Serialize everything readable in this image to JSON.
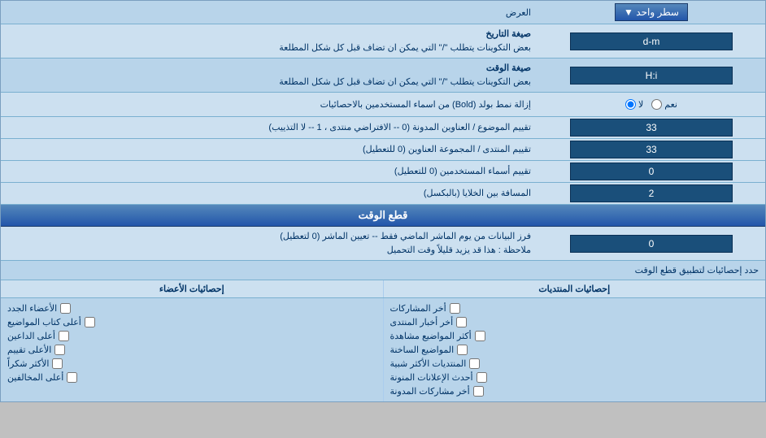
{
  "header": {
    "display_label": "العرض",
    "display_dropdown_label": "سطر واحد",
    "display_dropdown_icon": "▼"
  },
  "date_format": {
    "label": "صيغة التاريخ",
    "sublabel": "بعض التكوينات يتطلب \"/\" التي يمكن ان تضاف قبل كل شكل المطلعة",
    "value": "d-m"
  },
  "time_format": {
    "label": "صيغة الوقت",
    "sublabel": "بعض التكوينات يتطلب \"/\" التي يمكن ان تضاف قبل كل شكل المطلعة",
    "value": "H:i"
  },
  "bold_remove": {
    "label": "إزالة نمط بولد (Bold) من اسماء المستخدمين بالاحصائيات",
    "option_yes": "نعم",
    "option_no": "لا",
    "selected": "no"
  },
  "topic_sort": {
    "label": "تقييم الموضوع / العناوين المدونة (0 -- الافتراضي منتدى ، 1 -- لا التذييب)",
    "value": "33"
  },
  "forum_sort": {
    "label": "تقييم المنتدى / المجموعة العناوين (0 للتعطيل)",
    "value": "33"
  },
  "user_sort": {
    "label": "تقييم أسماء المستخدمين (0 للتعطيل)",
    "value": "0"
  },
  "cell_spacing": {
    "label": "المسافة بين الخلايا (بالبكسل)",
    "value": "2"
  },
  "cutoff_section": {
    "title": "قطع الوقت"
  },
  "cutoff_days": {
    "label": "فرز البيانات من يوم الماشر الماضي فقط -- تعيين الماشر (0 لتعطيل)",
    "sublabel": "ملاحظة : هذا قد يزيد قليلاً وقت التحميل",
    "value": "0"
  },
  "stats_apply": {
    "label": "حدد إحصائيات لتطبيق قطع الوقت"
  },
  "stats_columns": {
    "col1": "إحصائيات المنتديات",
    "col2": "إحصائيات الأعضاء"
  },
  "stats_col1_items": [
    "أخر المشاركات",
    "أخر أخبار المنتدى",
    "أكثر المواضيع مشاهدة",
    "المواضيع الساخنة",
    "المنتديات الأكثر شبية",
    "أحدث الإعلانات المنونة",
    "أخر مشاركات المدونة"
  ],
  "stats_col2_items": [
    "الأعضاء الجدد",
    "أعلى كتاب المواضيع",
    "أعلى الداعين",
    "الأعلى تقييم",
    "الأكثر شكراً",
    "أعلى المخالفين"
  ],
  "stats_col2_label": "إحصائيات الأعضاء",
  "stats_col1_label": "إحصائيات المنتديات"
}
